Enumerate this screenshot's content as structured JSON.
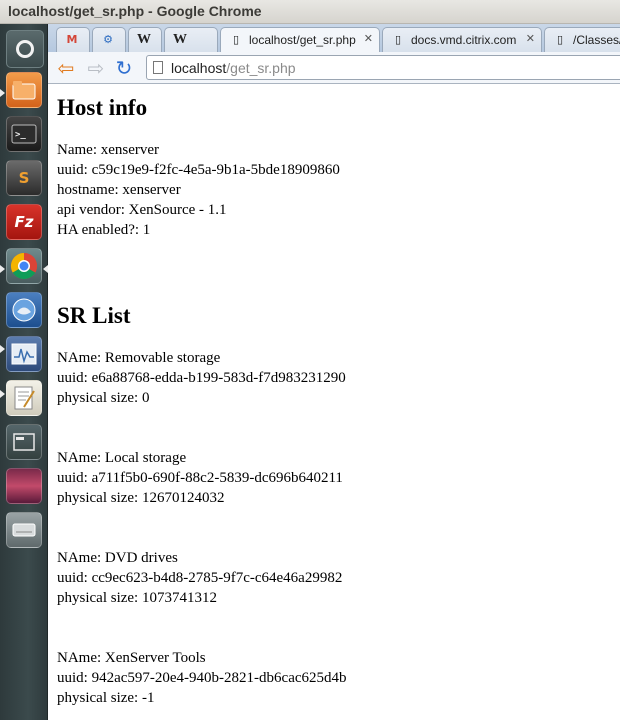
{
  "window": {
    "title": "localhost/get_sr.php - Google Chrome"
  },
  "tabs": [
    {
      "icon": "gmail-icon",
      "label": ""
    },
    {
      "icon": "gear-icon",
      "label": ""
    },
    {
      "icon": "wikipedia-icon",
      "label": ""
    },
    {
      "icon": "w-icon",
      "label": ""
    },
    {
      "icon": "page-icon",
      "label": "localhost/get_sr.php"
    },
    {
      "icon": "page-icon",
      "label": "docs.vmd.citrix.com"
    },
    {
      "icon": "page-icon",
      "label": "/Classes/h"
    }
  ],
  "omnibox": {
    "host": "localhost",
    "path": "/get_sr.php"
  },
  "host_info": {
    "heading": "Host info",
    "name": "Name: xenserver",
    "uuid": "uuid: c59c19e9-f2fc-4e5a-9b1a-5bde18909860",
    "hostname": "hostname: xenserver",
    "api_vendor": "api vendor: XenSource - 1.1",
    "ha": "HA enabled?: 1"
  },
  "sr_list": {
    "heading": "SR List",
    "items": [
      {
        "name": "NAme: Removable storage",
        "uuid": "uuid: e6a88768-edda-b199-583d-f7d983231290",
        "size": "physical size: 0"
      },
      {
        "name": "NAme: Local storage",
        "uuid": "uuid: a711f5b0-690f-88c2-5839-dc696b640211",
        "size": "physical size: 12670124032"
      },
      {
        "name": "NAme: DVD drives",
        "uuid": "uuid: cc9ec623-b4d8-2785-9f7c-c64e46a29982",
        "size": "physical size: 1073741312"
      },
      {
        "name": "NAme: XenServer Tools",
        "uuid": "uuid: 942ac597-20e4-940b-2821-db6cac625d4b",
        "size": "physical size: -1"
      }
    ]
  },
  "launcher": {
    "items": [
      "dash-home-icon",
      "files-icon",
      "terminal-icon",
      "sublime-text-icon",
      "filezilla-icon",
      "chrome-icon",
      "thunderbird-icon",
      "system-monitor-icon",
      "text-editor-icon",
      "workspace-switcher-icon",
      "wallpaper-icon",
      "drive-icon"
    ]
  },
  "colors": {
    "launcher_bg": "#3b4a4c",
    "tabstrip_bg": "#c9d7e8",
    "back_arrow": "#e07b20",
    "reload": "#2f6fd0"
  }
}
